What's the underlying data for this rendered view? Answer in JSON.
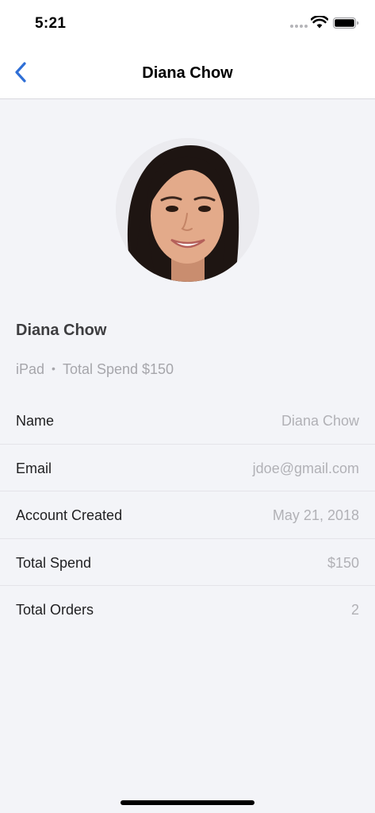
{
  "status_bar": {
    "time": "5:21"
  },
  "nav": {
    "title": "Diana Chow",
    "back_icon": "chevron-left-icon"
  },
  "profile": {
    "avatar": "profile-photo",
    "name": "Diana Chow",
    "device": "iPad",
    "separator": "•",
    "spend_summary": "Total Spend $150"
  },
  "details": [
    {
      "label": "Name",
      "value": "Diana Chow"
    },
    {
      "label": "Email",
      "value": "jdoe@gmail.com"
    },
    {
      "label": "Account Created",
      "value": "May 21, 2018"
    },
    {
      "label": "Total Spend",
      "value": "$150"
    },
    {
      "label": "Total Orders",
      "value": "2"
    }
  ],
  "colors": {
    "accent": "#2f6fd6",
    "background": "#f3f4f8",
    "muted_text": "#a6a6ab"
  }
}
